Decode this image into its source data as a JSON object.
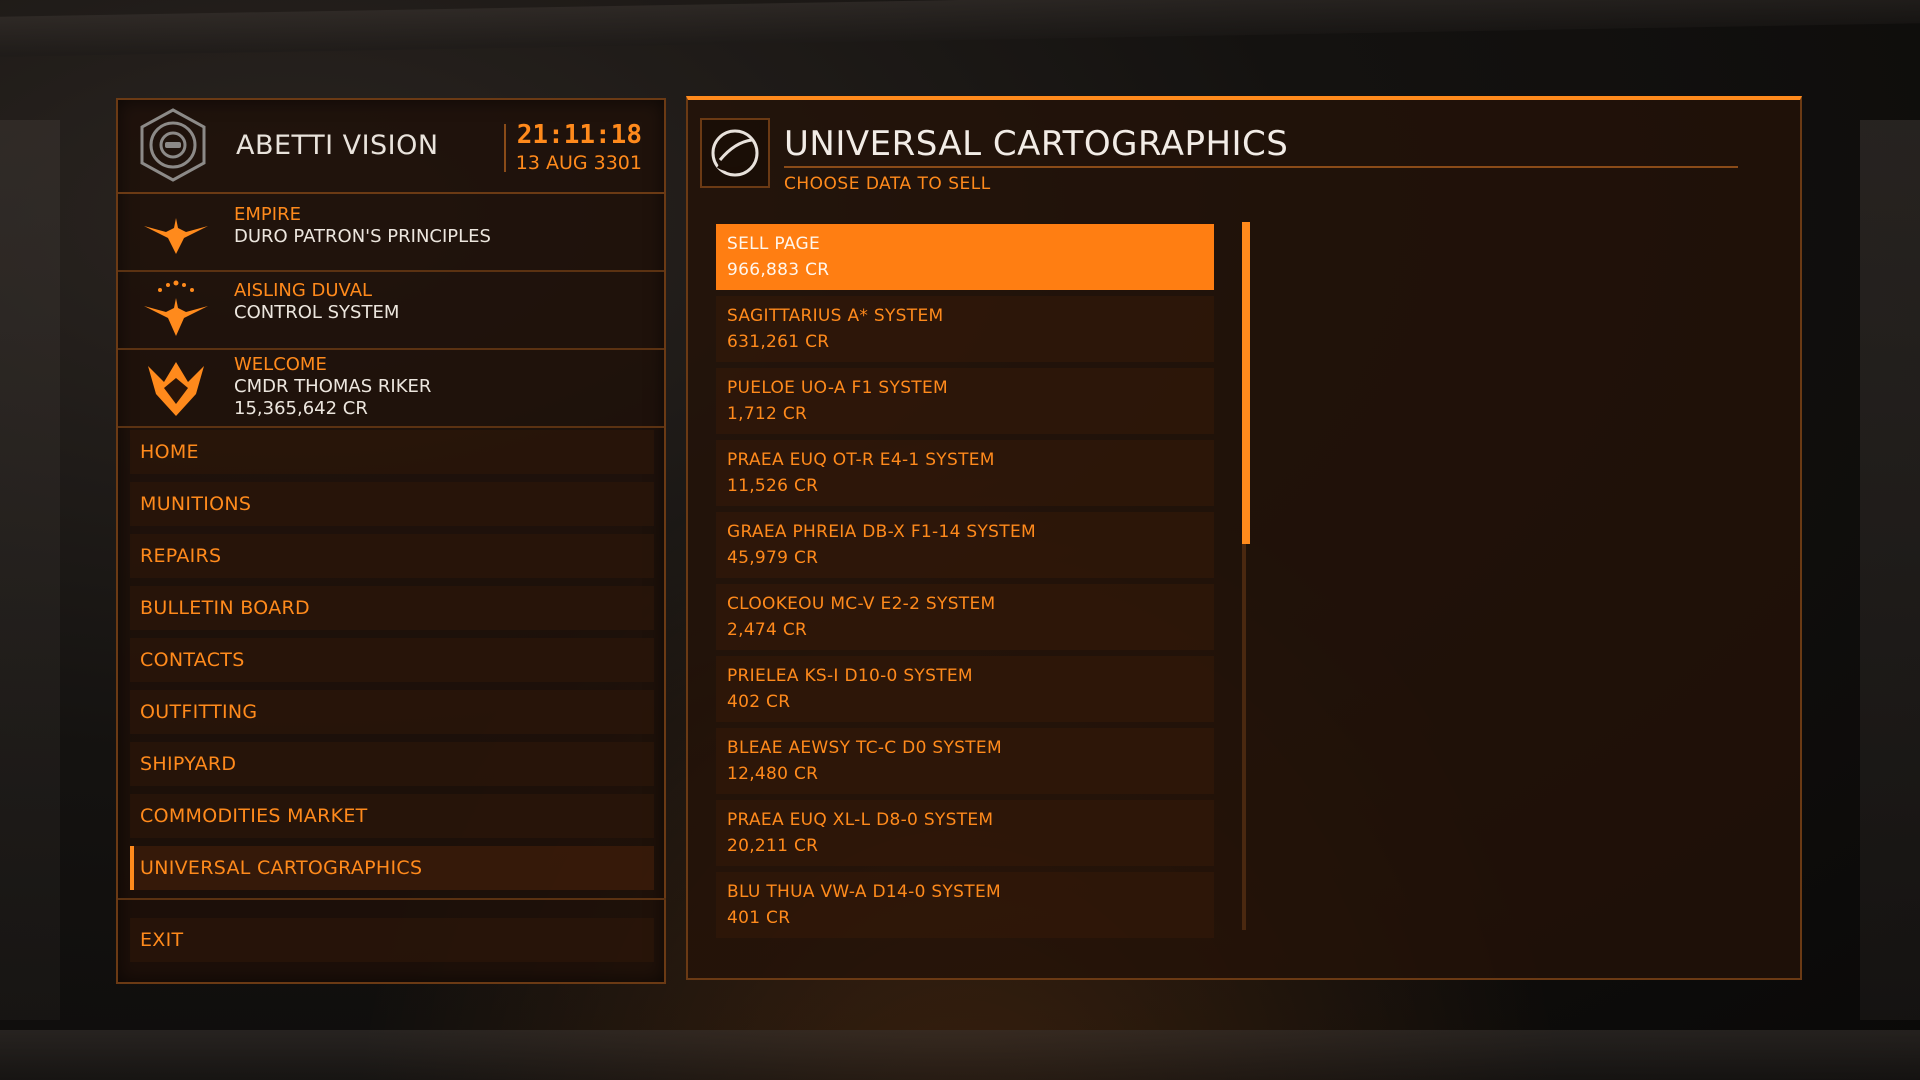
{
  "station": {
    "name": "ABETTI VISION",
    "time": "21:11:18",
    "date": "13 AUG 3301"
  },
  "info": {
    "allegiance_label": "EMPIRE",
    "allegiance_value": "DURO PATRON'S PRINCIPLES",
    "power_label": "AISLING DUVAL",
    "power_value": "CONTROL SYSTEM",
    "welcome_label": "WELCOME",
    "commander": "CMDR THOMAS RIKER",
    "credits": "15,365,642 CR"
  },
  "menu": {
    "items": [
      {
        "label": "HOME"
      },
      {
        "label": "MUNITIONS"
      },
      {
        "label": "REPAIRS"
      },
      {
        "label": "BULLETIN BOARD"
      },
      {
        "label": "CONTACTS"
      },
      {
        "label": "OUTFITTING"
      },
      {
        "label": "SHIPYARD"
      },
      {
        "label": "COMMODITIES MARKET"
      },
      {
        "label": "UNIVERSAL CARTOGRAPHICS"
      }
    ],
    "active": "UNIVERSAL CARTOGRAPHICS",
    "exit_label": "EXIT"
  },
  "cartographics": {
    "title": "UNIVERSAL CARTOGRAPHICS",
    "subtitle": "CHOOSE DATA TO SELL",
    "entries": [
      {
        "name": "SELL PAGE",
        "price": "966,883 CR"
      },
      {
        "name": "SAGITTARIUS A* SYSTEM",
        "price": "631,261 CR"
      },
      {
        "name": "PUELOE UO-A F1 SYSTEM",
        "price": "1,712 CR"
      },
      {
        "name": "PRAEA EUQ OT-R E4-1 SYSTEM",
        "price": "11,526 CR"
      },
      {
        "name": "GRAEA PHREIA DB-X F1-14 SYSTEM",
        "price": "45,979 CR"
      },
      {
        "name": "CLOOKEOU MC-V E2-2 SYSTEM",
        "price": "2,474 CR"
      },
      {
        "name": "PRIELEA KS-I D10-0 SYSTEM",
        "price": "402 CR"
      },
      {
        "name": "BLEAE AEWSY TC-C D0 SYSTEM",
        "price": "12,480 CR"
      },
      {
        "name": "PRAEA EUQ XL-L D8-0 SYSTEM",
        "price": "20,211 CR"
      },
      {
        "name": "BLU THUA VW-A D14-0 SYSTEM",
        "price": "401 CR"
      }
    ]
  },
  "colors": {
    "accent": "#ff8a1c",
    "selected_bg": "#ff7e12",
    "panel_border": "#6b3a14",
    "light_text": "#ece6de"
  },
  "icons": {
    "station": "station-emblem-icon",
    "empire": "empire-eagle-icon",
    "power": "aisling-duval-icon",
    "rank": "pilot-rank-icon",
    "cartographics": "cartographics-globe-icon"
  }
}
